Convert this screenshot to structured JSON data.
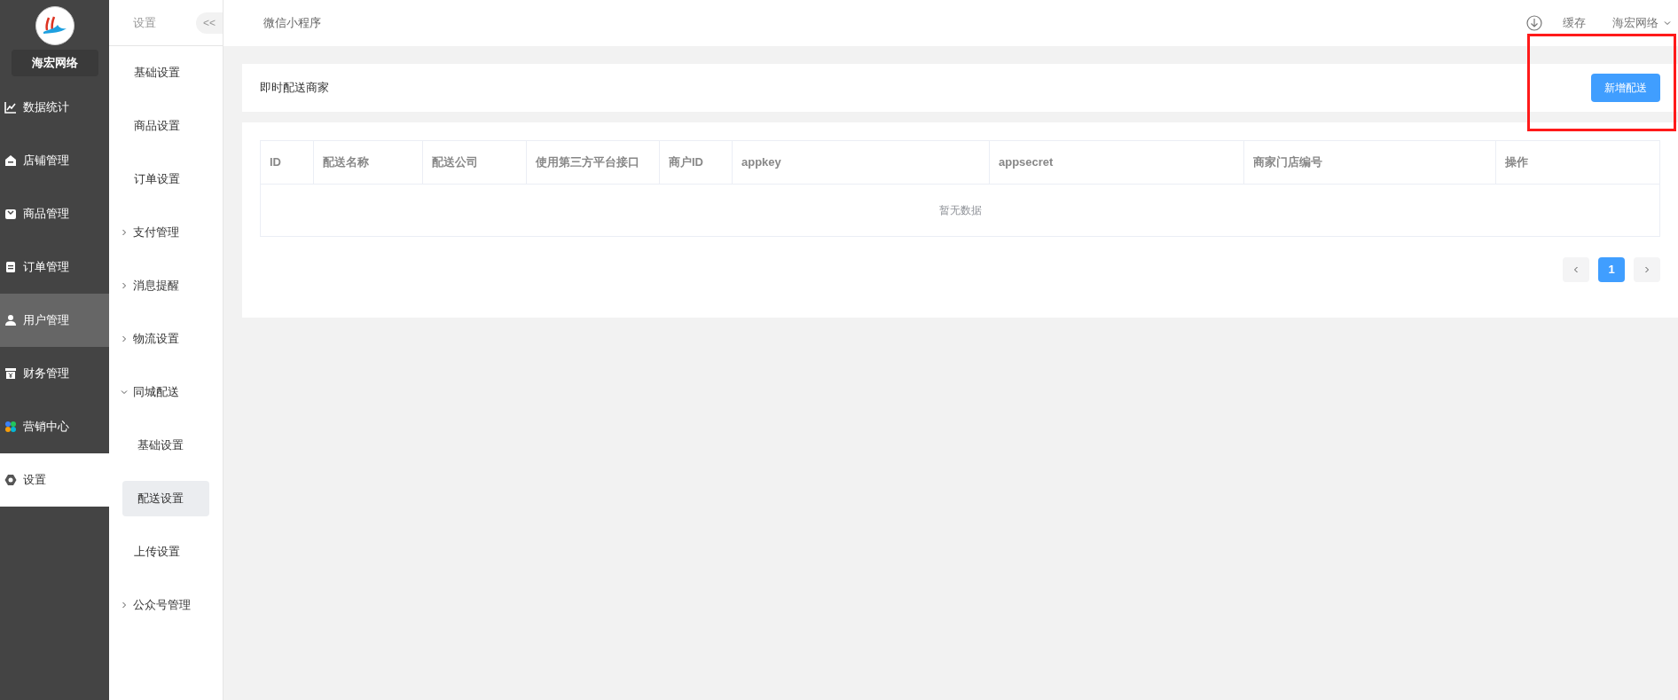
{
  "brand": {
    "name": "海宏网络"
  },
  "sidebar": {
    "items": [
      {
        "label": "数据统计",
        "selected": false,
        "highlighted": false
      },
      {
        "label": "店铺管理",
        "selected": false,
        "highlighted": false
      },
      {
        "label": "商品管理",
        "selected": false,
        "highlighted": false
      },
      {
        "label": "订单管理",
        "selected": false,
        "highlighted": false
      },
      {
        "label": "用户管理",
        "selected": false,
        "highlighted": true
      },
      {
        "label": "财务管理",
        "selected": false,
        "highlighted": false
      },
      {
        "label": "营销中心",
        "selected": false,
        "highlighted": false
      },
      {
        "label": "设置",
        "selected": true,
        "highlighted": false
      }
    ]
  },
  "submenu": {
    "title": "设置",
    "collapse_button": "<<",
    "items": [
      {
        "label": "基础设置",
        "selected": false
      },
      {
        "label": "商品设置",
        "selected": false
      },
      {
        "label": "订单设置",
        "selected": false
      },
      {
        "label": "支付管理",
        "selected": false,
        "expanded": false
      },
      {
        "label": "消息提醒",
        "selected": false,
        "expanded": false
      },
      {
        "label": "物流设置",
        "selected": false,
        "expanded": false
      },
      {
        "label": "同城配送",
        "selected": false,
        "expanded": true,
        "children": [
          {
            "label": "基础设置",
            "selected": false
          },
          {
            "label": "配送设置",
            "selected": true
          }
        ]
      },
      {
        "label": "上传设置",
        "selected": false
      },
      {
        "label": "公众号管理",
        "selected": false,
        "expanded": false
      }
    ]
  },
  "topbar": {
    "tab": "微信小程序",
    "cache": "缓存",
    "user": "海宏网络"
  },
  "header": {
    "title": "即时配送商家",
    "button": "新增配送",
    "highlighted": true
  },
  "table": {
    "columns": [
      "ID",
      "配送名称",
      "配送公司",
      "使用第三方平台接口",
      "商户ID",
      "appkey",
      "appsecret",
      "商家门店编号",
      "操作"
    ],
    "empty_text": "暂无数据"
  },
  "pagination": {
    "pages": [
      {
        "label": "1",
        "selected": true
      }
    ]
  }
}
